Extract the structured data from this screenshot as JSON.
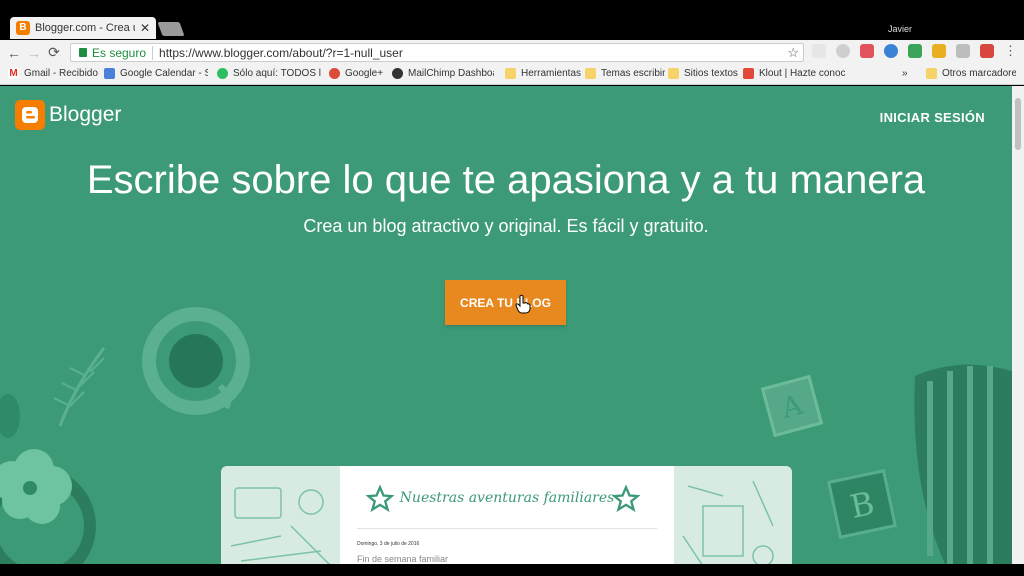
{
  "browser": {
    "tab_title": "Blogger.com - Crea un bl",
    "tab_favicon": "B",
    "tab_close": "✕",
    "user_name": "Javier",
    "security_label": "Es seguro",
    "url": "https://www.blogger.com/about/?r=1-null_user",
    "bookmarks_overflow": "»",
    "bookmarks": [
      {
        "label": "Gmail - Recibidos",
        "icon": "gmail-icon"
      },
      {
        "label": "Google Calendar - Se",
        "icon": "calendar-icon"
      },
      {
        "label": "Sólo aquí: TODOS los",
        "icon": "evernote-icon"
      },
      {
        "label": "Google+",
        "icon": "google-plus-icon"
      },
      {
        "label": "MailChimp Dashboar",
        "icon": "mailchimp-icon"
      },
      {
        "label": "Herramientas",
        "icon": "folder-icon"
      },
      {
        "label": "Temas escribir",
        "icon": "folder-icon"
      },
      {
        "label": "Sitios textos",
        "icon": "folder-icon"
      },
      {
        "label": "Klout | Hazte conocid",
        "icon": "klout-icon"
      },
      {
        "label": "Otros marcadores",
        "icon": "folder-icon"
      }
    ]
  },
  "site": {
    "logo_text": "Blogger",
    "signin_label": "INICIAR SESIÓN",
    "headline": "Escribe sobre lo que te apasiona y a tu manera",
    "subline": "Crea un blog atractivo y original. Es fácil y gratuito.",
    "cta_label": "CREA TU BLOG",
    "preview": {
      "title": "Nuestras aventuras familiares",
      "date": "Domingo, 3 de julio de 2016",
      "post_title": "Fin de semana familiar"
    }
  },
  "colors": {
    "page_bg": "#3d9a77",
    "brand_orange": "#f57d00",
    "cta_orange": "#e8891f"
  }
}
